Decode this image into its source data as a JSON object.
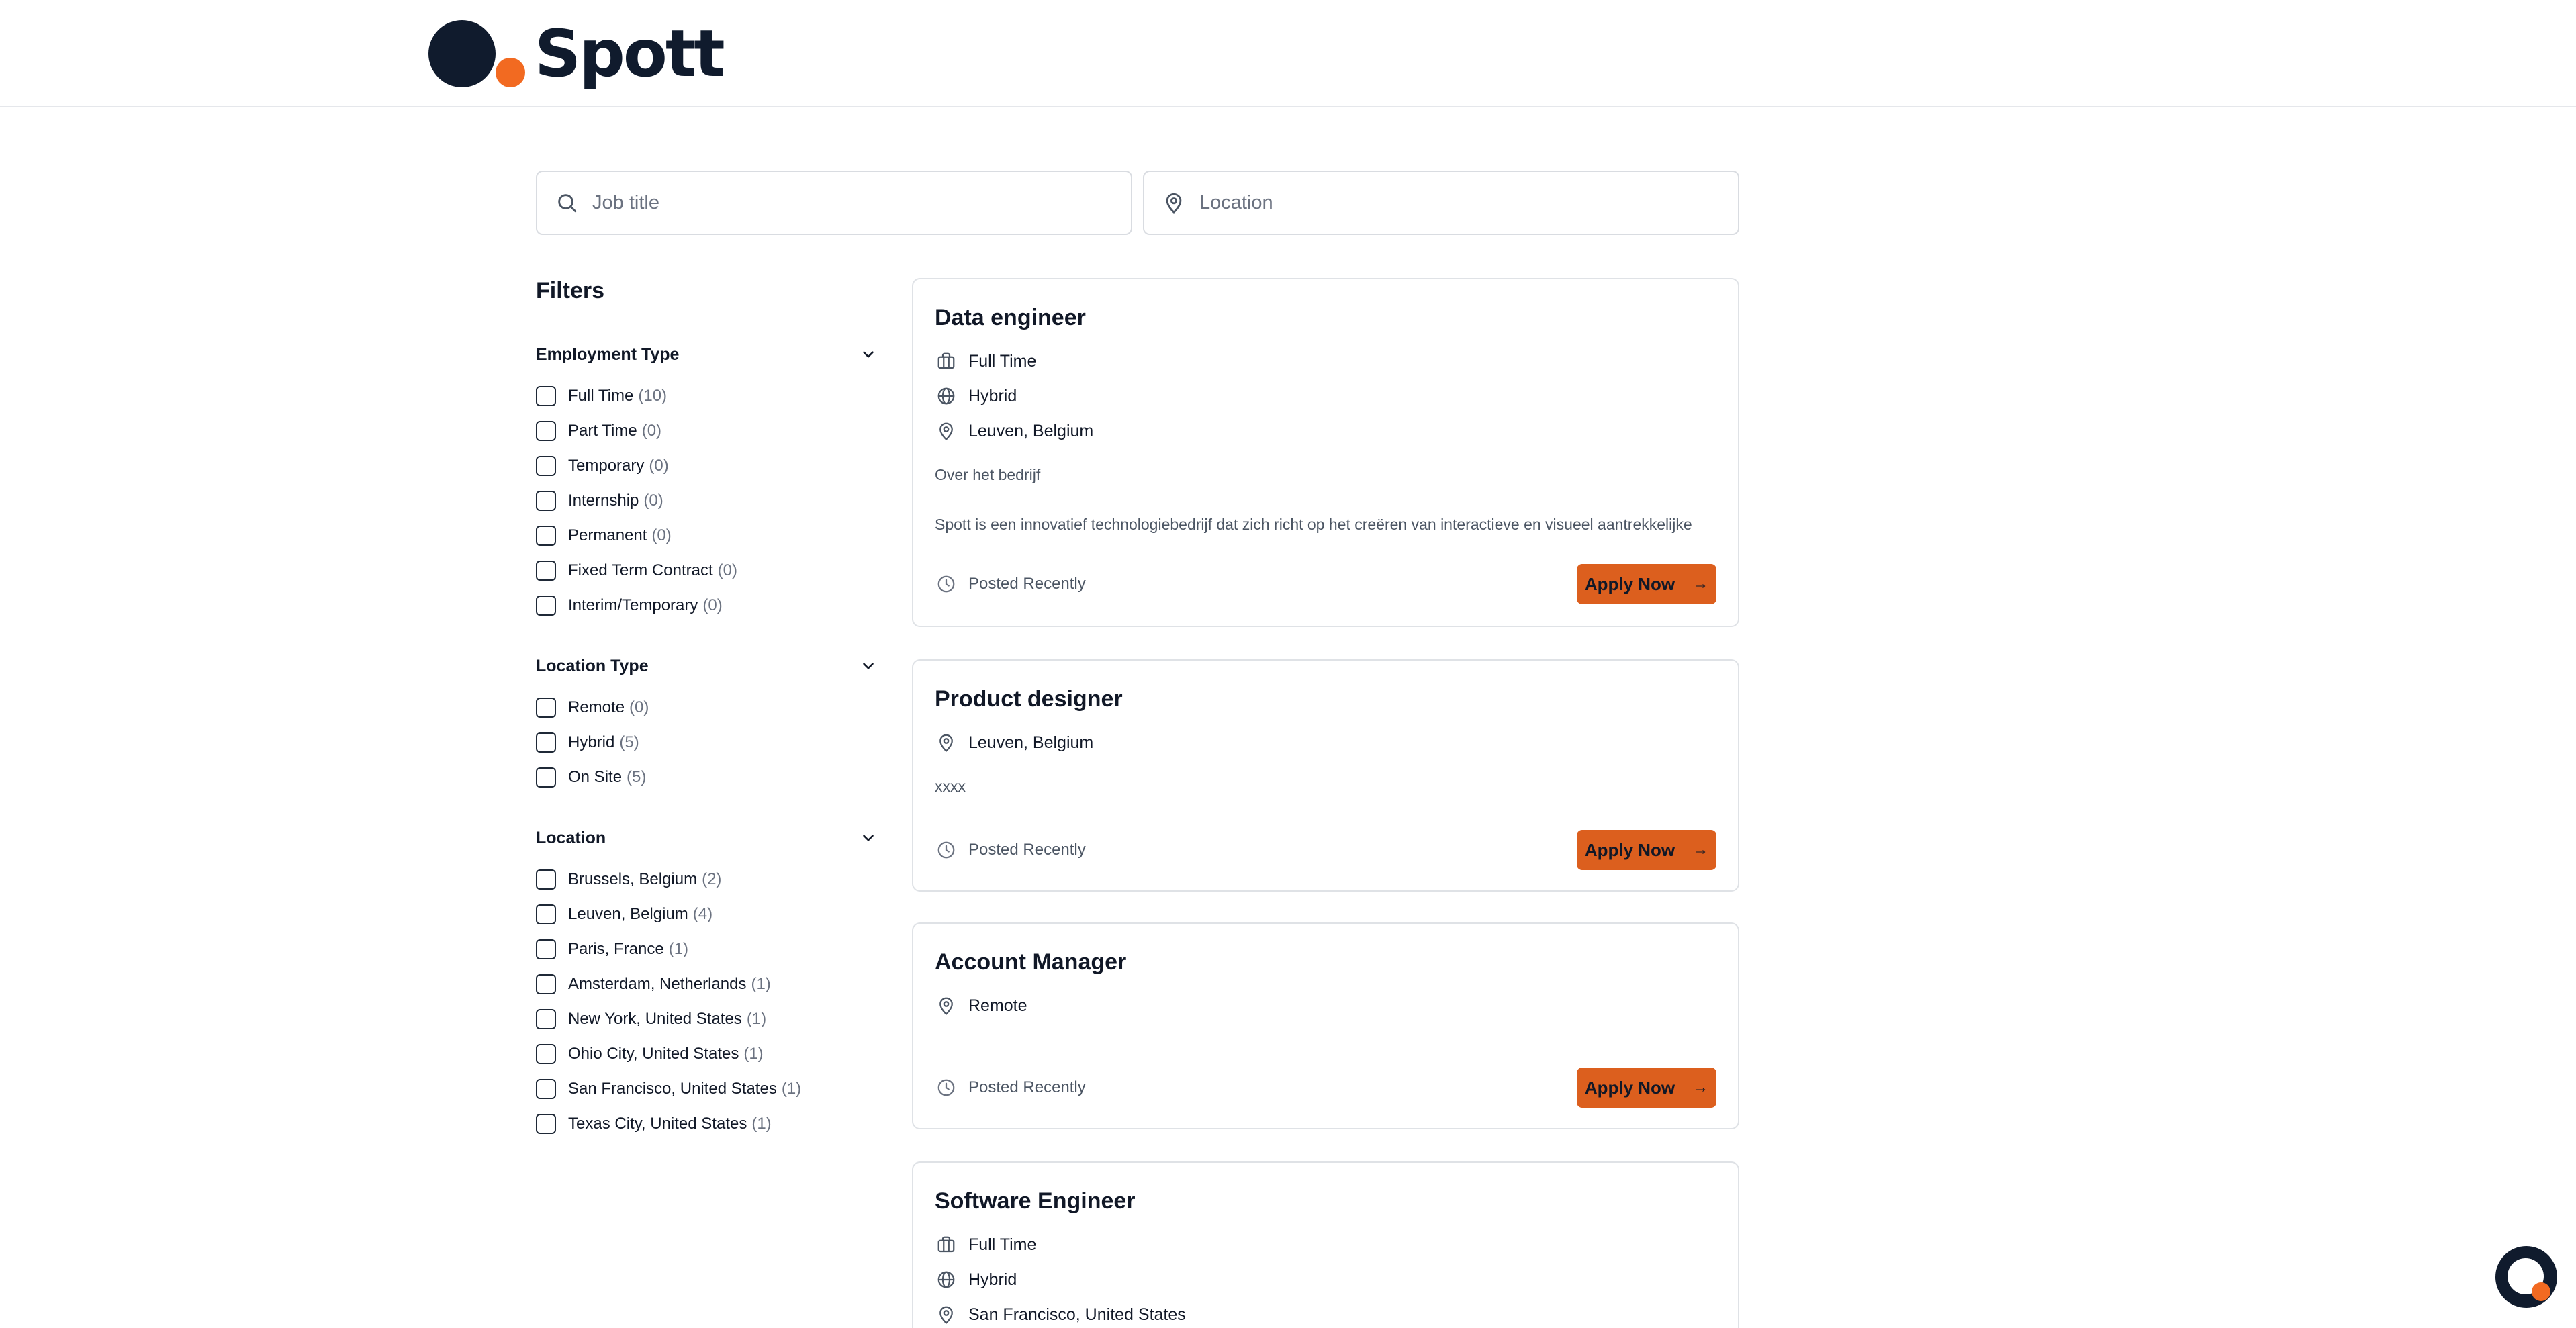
{
  "brand": {
    "name": "Spott",
    "dark_color": "#101b2d",
    "accent_color": "#f26a21"
  },
  "search": {
    "job_placeholder": "Job title",
    "location_placeholder": "Location",
    "job_icon": "search-icon",
    "location_icon": "map-pin-icon"
  },
  "filters": {
    "title": "Filters",
    "employment_type": {
      "title": "Employment Type",
      "options": [
        {
          "label": "Full Time",
          "count": "(10)"
        },
        {
          "label": "Part Time",
          "count": "(0)"
        },
        {
          "label": "Temporary",
          "count": "(0)"
        },
        {
          "label": "Internship",
          "count": "(0)"
        },
        {
          "label": "Permanent",
          "count": "(0)"
        },
        {
          "label": "Fixed Term Contract",
          "count": "(0)"
        },
        {
          "label": "Interim/Temporary",
          "count": "(0)"
        }
      ]
    },
    "location_type": {
      "title": "Location Type",
      "options": [
        {
          "label": "Remote",
          "count": "(0)"
        },
        {
          "label": "Hybrid",
          "count": "(5)"
        },
        {
          "label": "On Site",
          "count": "(5)"
        }
      ]
    },
    "location": {
      "title": "Location",
      "options": [
        {
          "label": "Brussels, Belgium",
          "count": "(2)"
        },
        {
          "label": "Leuven, Belgium",
          "count": "(4)"
        },
        {
          "label": "Paris, France",
          "count": "(1)"
        },
        {
          "label": "Amsterdam, Netherlands",
          "count": "(1)"
        },
        {
          "label": "New York, United States",
          "count": "(1)"
        },
        {
          "label": "Ohio City, United States",
          "count": "(1)"
        },
        {
          "label": "San Francisco, United States",
          "count": "(1)"
        },
        {
          "label": "Texas City, United States",
          "count": "(1)"
        }
      ]
    }
  },
  "jobs": [
    {
      "title": "Data engineer",
      "employment": "Full Time",
      "location_type": "Hybrid",
      "location": "Leuven, Belgium",
      "desc_heading": "Over het bedrijf",
      "desc": "Spott is een innovatief technologiebedrijf dat zich richt op het creëren van interactieve en visueel aantrekkelijke",
      "posted": "Posted Recently",
      "apply": "Apply Now"
    },
    {
      "title": "Product designer",
      "location": "Leuven, Belgium",
      "desc": "xxxx",
      "posted": "Posted Recently",
      "apply": "Apply Now"
    },
    {
      "title": "Account Manager",
      "location": "Remote",
      "posted": "Posted Recently",
      "apply": "Apply Now"
    },
    {
      "title": "Software Engineer",
      "employment": "Full Time",
      "location_type": "Hybrid",
      "location": "San Francisco, United States"
    }
  ],
  "chat_widget": {
    "icon": "chat-widget-icon"
  }
}
